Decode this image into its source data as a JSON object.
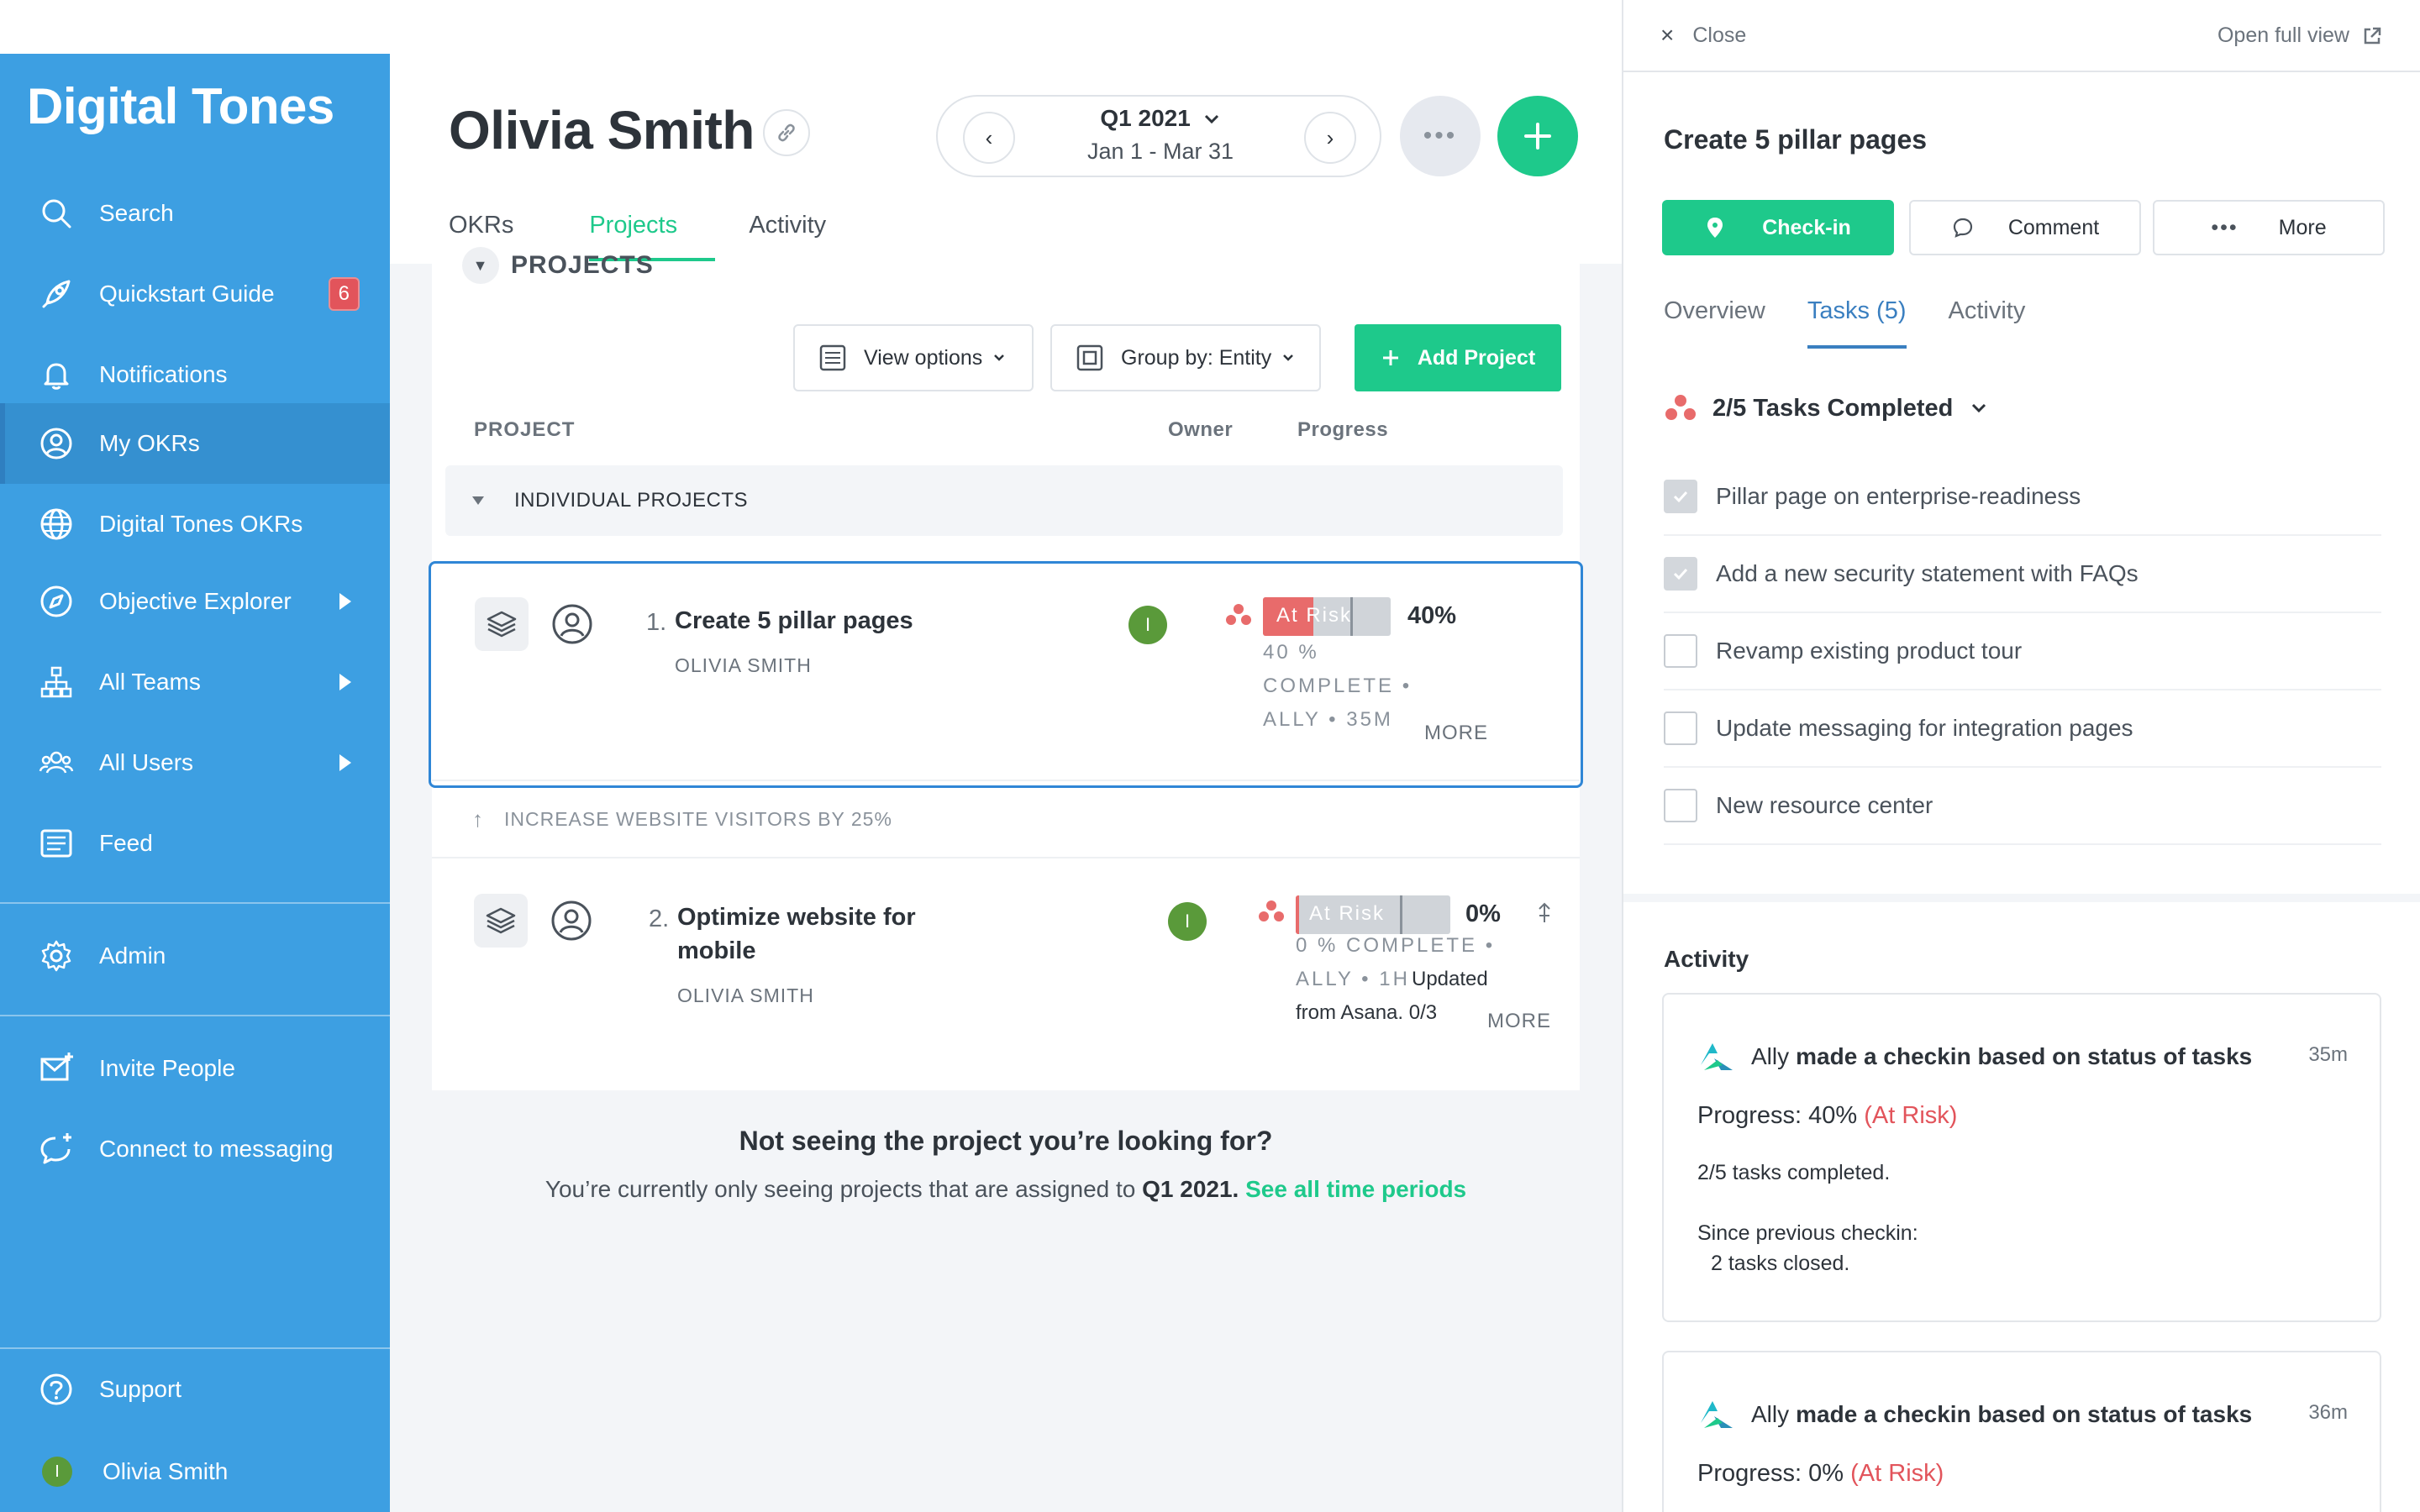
{
  "sidebar": {
    "brand": "Digital Tones",
    "items": [
      {
        "label": "Search",
        "icon": "search-icon"
      },
      {
        "label": "Quickstart Guide",
        "icon": "rocket-icon",
        "badge": "6"
      },
      {
        "label": "Notifications",
        "icon": "bell-icon"
      },
      {
        "label": "My OKRs",
        "icon": "user-circle-icon",
        "active": true
      },
      {
        "label": "Digital Tones OKRs",
        "icon": "globe-icon"
      },
      {
        "label": "Objective Explorer",
        "icon": "compass-icon"
      },
      {
        "label": "All Teams",
        "icon": "org-chart-icon"
      },
      {
        "label": "All Users",
        "icon": "users-icon"
      },
      {
        "label": "Feed",
        "icon": "feed-icon"
      },
      {
        "label": "Admin",
        "icon": "gear-icon"
      },
      {
        "label": "Invite People",
        "icon": "invite-mail-icon"
      },
      {
        "label": "Connect to messaging",
        "icon": "chat-icon"
      },
      {
        "label": "Support",
        "icon": "help-icon"
      },
      {
        "label": "Olivia Smith",
        "avatar_initial": "I"
      }
    ]
  },
  "header": {
    "title": "Olivia Smith",
    "period": {
      "quarter": "Q1 2021",
      "range": "Jan 1 - Mar 31"
    },
    "more_label": "•••",
    "tabs": [
      {
        "label": "OKRs"
      },
      {
        "label": "Projects",
        "active": true
      },
      {
        "label": "Activity"
      }
    ]
  },
  "projects": {
    "section_title": "PROJECTS",
    "view_options": "View options",
    "group_by": "Group by: Entity",
    "add_project": "Add Project",
    "columns": {
      "project": "PROJECT",
      "owner": "Owner",
      "progress": "Progress"
    },
    "group_label": "INDIVIDUAL PROJECTS",
    "rows": [
      {
        "number": "1.",
        "name": "Create 5 pillar pages",
        "owner": "OLIVIA SMITH",
        "owner_initial": "I",
        "status": "At Risk",
        "percent": "40%",
        "progress_value": 40,
        "meta_line1": "40 %",
        "meta_line2": "COMPLETE •",
        "meta_line3": "ALLY • 35M",
        "more": "MORE"
      },
      {
        "number": "2.",
        "name_line1": "Optimize website for",
        "name_line2": "mobile",
        "owner": "OLIVIA SMITH",
        "owner_initial": "I",
        "status": "At Risk",
        "percent": "0%",
        "progress_value": 0,
        "meta_line1": "0 % COMPLETE •",
        "meta_line2a": "ALLY • 1H",
        "meta_line2b": "Updated",
        "meta_line3": "from Asana. 0/3",
        "more": "MORE"
      }
    ],
    "linked_objective": "INCREASE WEBSITE VISITORS BY 25%",
    "empty_title": "Not seeing the project you’re looking for?",
    "empty_sub_prefix": "You’re currently only seeing projects that are assigned to ",
    "empty_sub_period": "Q1 2021.",
    "empty_sub_link": "See all time periods"
  },
  "panel": {
    "close": "Close",
    "open_full": "Open full view",
    "title": "Create 5 pillar pages",
    "checkin": "Check-in",
    "comment": "Comment",
    "more": "More",
    "tabs": [
      {
        "label": "Overview"
      },
      {
        "label": "Tasks (5)",
        "active": true
      },
      {
        "label": "Activity"
      }
    ],
    "tasks_summary": "2/5 Tasks Completed",
    "tasks": [
      {
        "label": "Pillar page on enterprise-readiness",
        "done": true
      },
      {
        "label": "Add a new security statement with FAQs",
        "done": true
      },
      {
        "label": "Revamp existing product tour",
        "done": false
      },
      {
        "label": "Update messaging for integration pages",
        "done": false
      },
      {
        "label": "New resource center",
        "done": false
      }
    ],
    "activity_title": "Activity",
    "activity": [
      {
        "actor": "Ally",
        "action": "made a checkin based on status of tasks",
        "time": "35m",
        "progress_label": "Progress: 40%",
        "risk": "(At Risk)",
        "line1": "2/5 tasks completed.",
        "line2": "Since previous checkin:",
        "line3": "2 tasks closed."
      },
      {
        "actor": "Ally",
        "action": "made a checkin based on status of tasks",
        "time": "36m",
        "progress_label": "Progress: 0%",
        "risk": "(At Risk)"
      }
    ]
  },
  "colors": {
    "sidebar": "#3d9fe2",
    "accent_green": "#1ec98b",
    "risk_red": "#e86b6b",
    "tab_blue": "#3a7fc0"
  }
}
